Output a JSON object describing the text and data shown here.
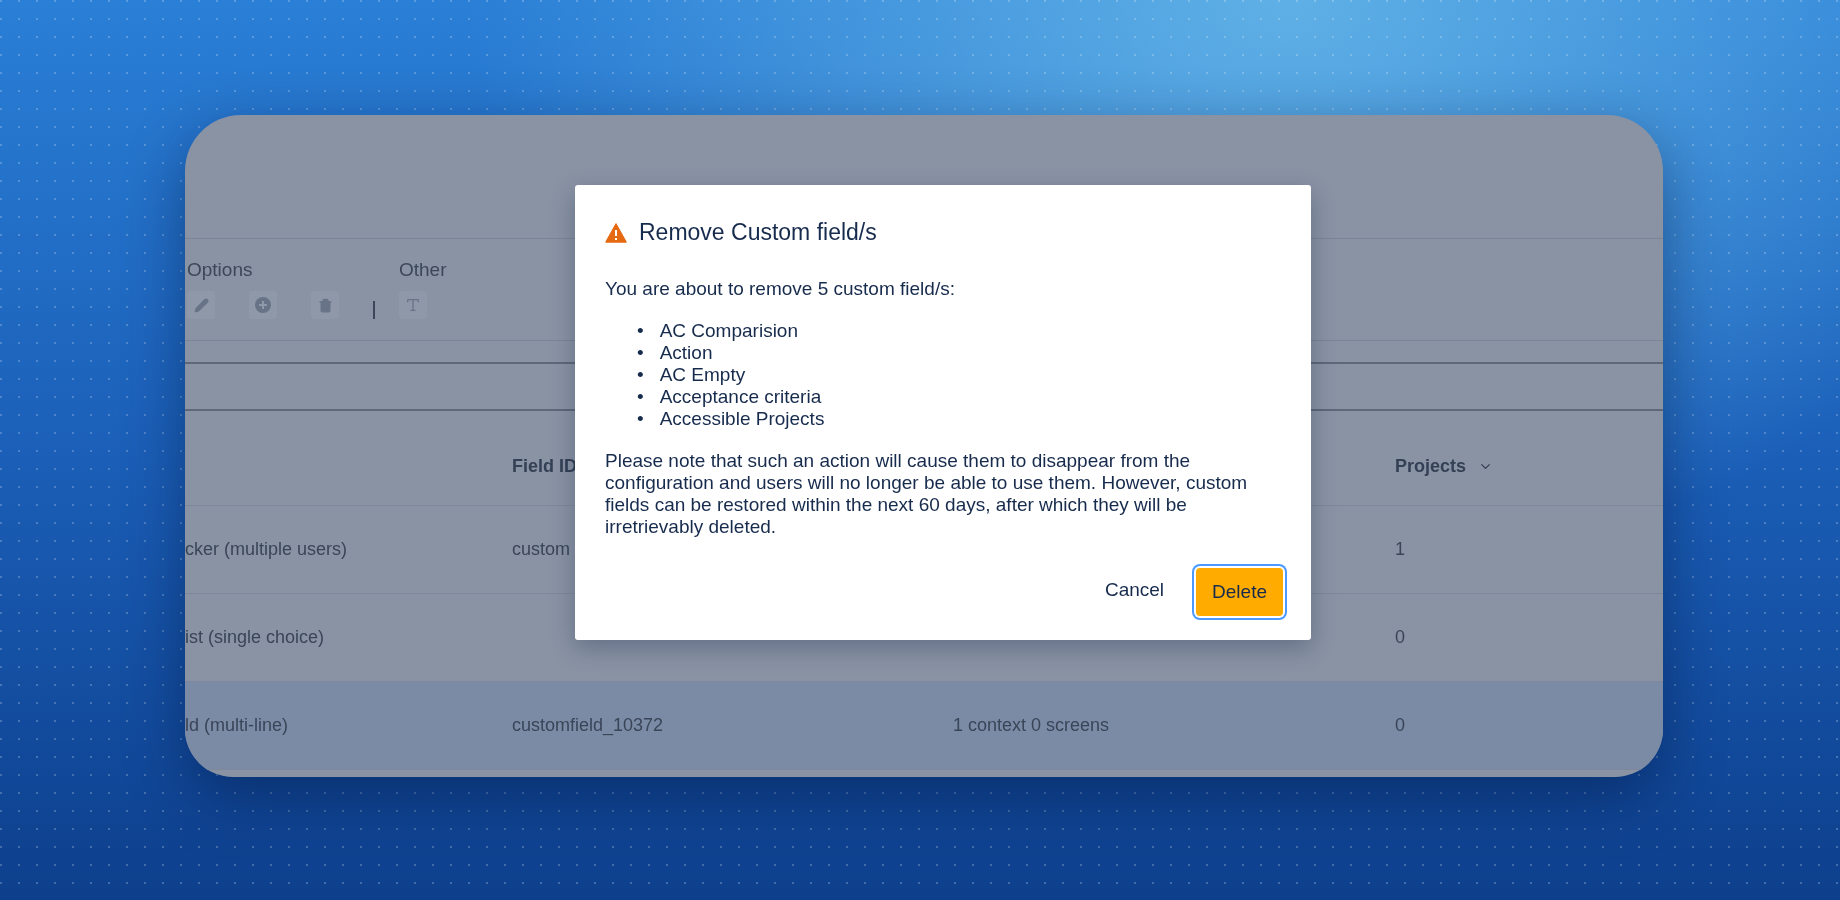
{
  "toolbar": {
    "groups": [
      {
        "label": "Options",
        "tools": [
          {
            "kind": "edit"
          },
          {
            "kind": "add"
          },
          {
            "kind": "delete"
          }
        ]
      },
      {
        "label": "Other",
        "tools": [
          {
            "kind": "text"
          }
        ]
      }
    ]
  },
  "table": {
    "header": {
      "column_2": {
        "label": "Field ID"
      },
      "column_4": {
        "label": "Projects",
        "sorted": true
      }
    },
    "rows": [
      {
        "column_1": "cker (multiple users)",
        "column_2": "custom",
        "column_4": "1",
        "highlighted": false
      },
      {
        "column_1": "ist (single choice)",
        "column_4": "0",
        "highlighted": false
      },
      {
        "column_1": "ld (multi-line)",
        "column_2": "customfield_10372",
        "column_3": "1 context 0 screens",
        "column_4": "0",
        "highlighted": true
      }
    ]
  },
  "dialog": {
    "title": "Remove Custom field/s",
    "intro": "You are about to remove 5 custom field/s:",
    "items": [
      {
        "bullet": "•",
        "text": "AC Comparision"
      },
      {
        "bullet": "•",
        "text": "Action"
      },
      {
        "bullet": "•",
        "text": "AC Empty"
      },
      {
        "bullet": "•",
        "text": "Acceptance criteria"
      },
      {
        "bullet": "•",
        "text": "Accessible Projects"
      }
    ],
    "note": "Please note that such an action will cause them to disappear from the configuration and users will no longer be able to use them. However, custom fields can be restored within the next 60 days, after which they will be irretrievably deleted.",
    "buttons": [
      {
        "label": "Cancel",
        "kind": "subtle",
        "focused": false
      },
      {
        "label": "Delete",
        "kind": "warning",
        "focused": true
      }
    ]
  }
}
